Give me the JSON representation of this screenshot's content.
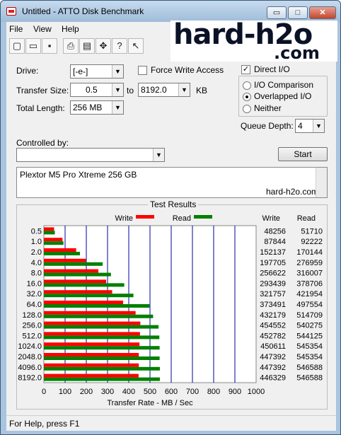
{
  "window": {
    "title": "Untitled - ATTO Disk Benchmark"
  },
  "title_buttons": {
    "minimize": "▭",
    "maximize": "□",
    "close": "✕"
  },
  "menu": [
    "File",
    "View",
    "Help"
  ],
  "toolbar": [
    "new-icon",
    "open-icon",
    "save-icon",
    "print-icon",
    "print-preview-icon",
    "move-icon",
    "help-icon",
    "context-help-icon"
  ],
  "logo": {
    "line1": "hard-h2o",
    "line2": ".com"
  },
  "settings": {
    "drive_label": "Drive:",
    "drive_value": "[-e-]",
    "force_write_label": "Force Write Access",
    "force_write_checked": false,
    "direct_io_label": "Direct I/O",
    "direct_io_checked": true,
    "transfer_size_label": "Transfer Size:",
    "transfer_from": "0.5",
    "to_label": "to",
    "transfer_to": "8192.0",
    "kb_label": "KB",
    "total_length_label": "Total Length:",
    "total_length_value": "256 MB",
    "io_options": [
      "I/O Comparison",
      "Overlapped I/O",
      "Neither"
    ],
    "io_selected": 1,
    "queue_depth_label": "Queue Depth:",
    "queue_depth_value": "4",
    "controlled_by_label": "Controlled by:",
    "controlled_by_value": "",
    "start_label": "Start"
  },
  "description": {
    "line1": "Plextor M5 Pro Xtreme 256 GB",
    "line2": "hard-h2o.com"
  },
  "chart_data": {
    "type": "bar",
    "title": "Test Results",
    "xlabel": "Transfer Rate - MB / Sec",
    "xlim": [
      0,
      1000
    ],
    "xticks": [
      0,
      100,
      200,
      300,
      400,
      500,
      600,
      700,
      800,
      900,
      1000
    ],
    "categories": [
      "0.5",
      "1.0",
      "2.0",
      "4.0",
      "8.0",
      "16.0",
      "32.0",
      "64.0",
      "128.0",
      "256.0",
      "512.0",
      "1024.0",
      "2048.0",
      "4096.0",
      "8192.0"
    ],
    "legend": [
      "Write",
      "Read"
    ],
    "colors": {
      "write": "#ff0000",
      "read": "#008000",
      "grid": "#0000a0"
    },
    "write_header": "Write",
    "read_header": "Read",
    "write_values": [
      48256,
      87844,
      152137,
      197705,
      256622,
      293439,
      321757,
      373491,
      432179,
      454552,
      452782,
      450611,
      447392,
      447392,
      446329
    ],
    "read_values": [
      51710,
      92222,
      170144,
      276959,
      316007,
      378706,
      421954,
      497554,
      514709,
      540275,
      544125,
      545354,
      545354,
      546588,
      546588
    ]
  },
  "status": {
    "text": "For Help, press F1"
  }
}
